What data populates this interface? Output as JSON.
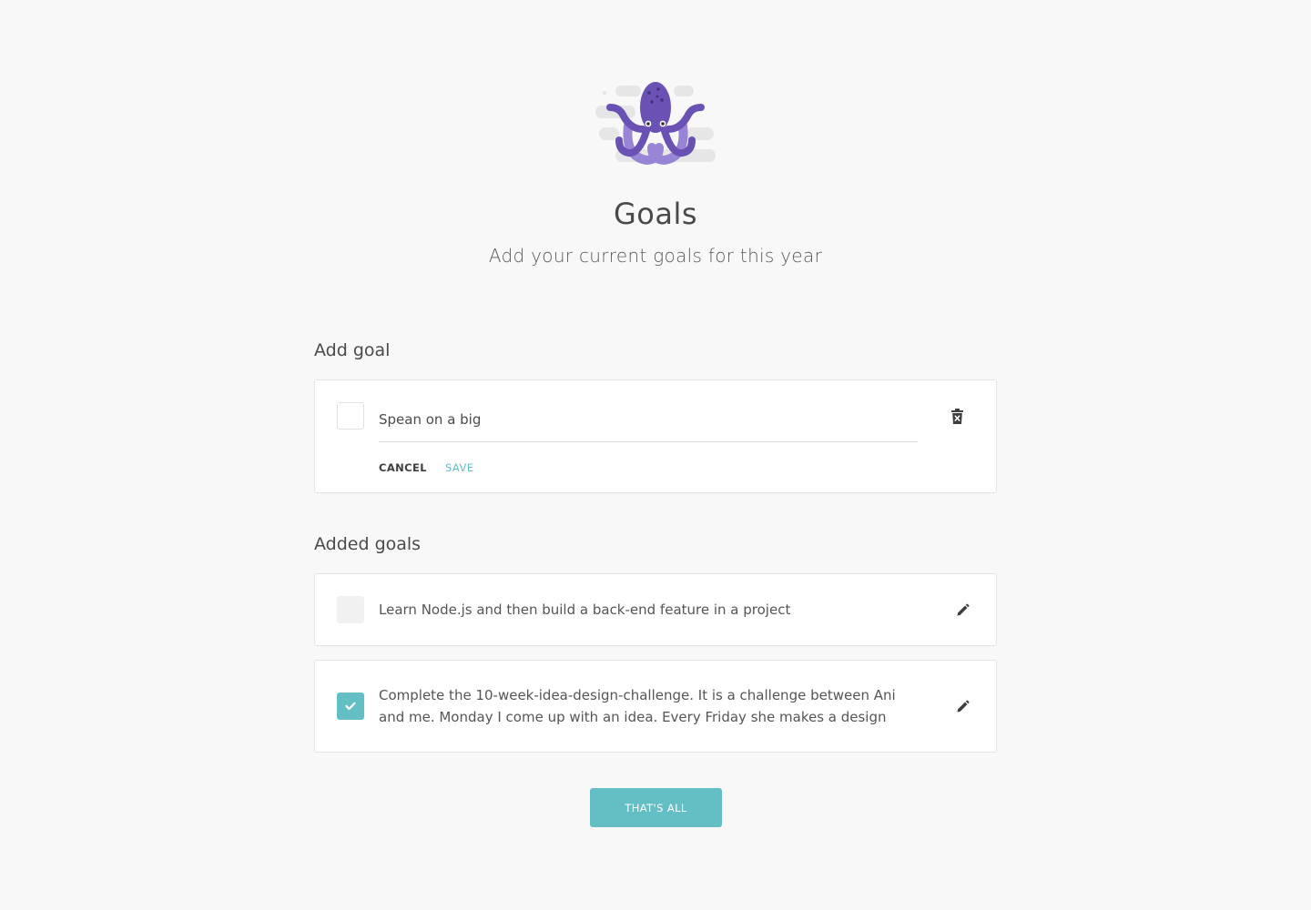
{
  "header": {
    "title": "Goals",
    "subtitle": "Add your current goals for this year",
    "mascot_icon": "octopus-mascot"
  },
  "add_goal": {
    "heading": "Add goal",
    "input_value": "Spean on a big",
    "cancel_label": "CANCEL",
    "save_label": "SAVE",
    "delete_icon": "trash-icon"
  },
  "added_goals": {
    "heading": "Added goals",
    "items": [
      {
        "text": "Learn Node.js and then build a back-end feature in a project",
        "completed": false,
        "edit_icon": "pencil-icon"
      },
      {
        "text": "Complete the 10-week-idea-design-challenge. It is a challenge between Ani and me. Monday I come up with an idea. Every Friday she makes a design",
        "completed": true,
        "edit_icon": "pencil-icon"
      }
    ]
  },
  "footer": {
    "done_label": "THAT'S ALL"
  },
  "colors": {
    "accent": "#64bfc5",
    "mascot_primary": "#6a52b5",
    "mascot_secondary": "#9885d6",
    "background": "#f8f8f8"
  }
}
